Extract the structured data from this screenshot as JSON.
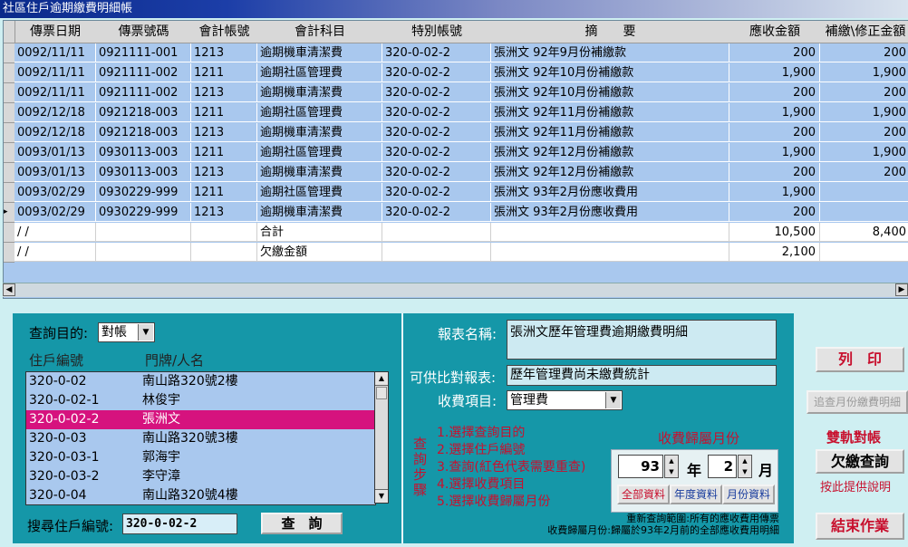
{
  "window": {
    "title": "社區住戶逾期繳費明細帳"
  },
  "grid": {
    "columns": [
      "傳票日期",
      "傳票號碼",
      "會計帳號",
      "會計科目",
      "特別帳號",
      "摘　　要",
      "應收金額",
      "補繳\\修正金額"
    ],
    "rows": [
      [
        "0092/11/11",
        "0921111-001",
        "1213",
        "逾期機車清潔費",
        "320-0-02-2",
        "張洲文 92年9月份補繳款",
        "200",
        "200"
      ],
      [
        "0092/11/11",
        "0921111-002",
        "1211",
        "逾期社區管理費",
        "320-0-02-2",
        "張洲文 92年10月份補繳款",
        "1,900",
        "1,900"
      ],
      [
        "0092/11/11",
        "0921111-002",
        "1213",
        "逾期機車清潔費",
        "320-0-02-2",
        "張洲文 92年10月份補繳款",
        "200",
        "200"
      ],
      [
        "0092/12/18",
        "0921218-003",
        "1211",
        "逾期社區管理費",
        "320-0-02-2",
        "張洲文 92年11月份補繳款",
        "1,900",
        "1,900"
      ],
      [
        "0092/12/18",
        "0921218-003",
        "1213",
        "逾期機車清潔費",
        "320-0-02-2",
        "張洲文 92年11月份補繳款",
        "200",
        "200"
      ],
      [
        "0093/01/13",
        "0930113-003",
        "1211",
        "逾期社區管理費",
        "320-0-02-2",
        "張洲文 92年12月份補繳款",
        "1,900",
        "1,900"
      ],
      [
        "0093/01/13",
        "0930113-003",
        "1213",
        "逾期機車清潔費",
        "320-0-02-2",
        "張洲文 92年12月份補繳款",
        "200",
        "200"
      ],
      [
        "0093/02/29",
        "0930229-999",
        "1211",
        "逾期社區管理費",
        "320-0-02-2",
        "張洲文 93年2月份應收費用",
        "1,900",
        ""
      ],
      [
        "0093/02/29",
        "0930229-999",
        "1213",
        "逾期機車清潔費",
        "320-0-02-2",
        "張洲文 93年2月份應收費用",
        "200",
        ""
      ]
    ],
    "summary": [
      [
        "/    /",
        "",
        "",
        "合計",
        "",
        "",
        "10,500",
        "8,400"
      ],
      [
        "/    /",
        "",
        "",
        "欠繳金額",
        "",
        "",
        "2,100",
        ""
      ]
    ],
    "row_pointer": "▸"
  },
  "query": {
    "purpose_label": "查詢目的:",
    "purpose_value": "對帳",
    "list_headers": [
      "住戶編號",
      "門牌/人名"
    ],
    "list_items": [
      [
        "320-0-02",
        "南山路320號2樓"
      ],
      [
        "320-0-02-1",
        "林俊宇"
      ],
      [
        "320-0-02-2",
        "張洲文"
      ],
      [
        "320-0-03",
        "南山路320號3樓"
      ],
      [
        "320-0-03-1",
        "郭海宇"
      ],
      [
        "320-0-03-2",
        "李守漳"
      ],
      [
        "320-0-04",
        "南山路320號4樓"
      ]
    ],
    "selected_index": 2,
    "search_label": "搜尋住戶編號:",
    "search_value": "320-0-02-2",
    "query_button": "查　詢"
  },
  "report": {
    "name_label": "報表名稱:",
    "name_value": "張洲文歷年管理費逾期繳費明細",
    "compare_label": "可供比對報表:",
    "compare_value": "歷年管理費尚未繳費統計",
    "fee_item_label": "收費項目:",
    "fee_item_value": "管理費",
    "steps_title": "查詢步驟",
    "steps": [
      "1.選擇查詢目的",
      "2.選擇住戶編號",
      "3.查詢(紅色代表需要重查)",
      "4.選擇收費項目",
      "5.選擇收費歸屬月份"
    ],
    "month_title": "收費歸屬月份",
    "year_value": "93",
    "year_unit": "年",
    "month_value": "2",
    "month_unit": "月",
    "btn_all": "全部資料",
    "btn_year": "年度資料",
    "btn_month": "月份資料",
    "note1": "重新查詢範圍:所有的應收費用傳票",
    "note2": "收費歸屬月份:歸屬於93年2月前的全部應收費用明細"
  },
  "side": {
    "print": "列　印",
    "track": "追查月份繳費明細",
    "dual": "雙軌對帳",
    "arrears": "欠繳查詢",
    "hint": "按此提供說明",
    "exit": "結束作業"
  },
  "colors": {
    "grid_row": "#a9c8ee",
    "panel": "#1597a8",
    "selected": "#d6127e",
    "accent_red": "#c8102e"
  }
}
